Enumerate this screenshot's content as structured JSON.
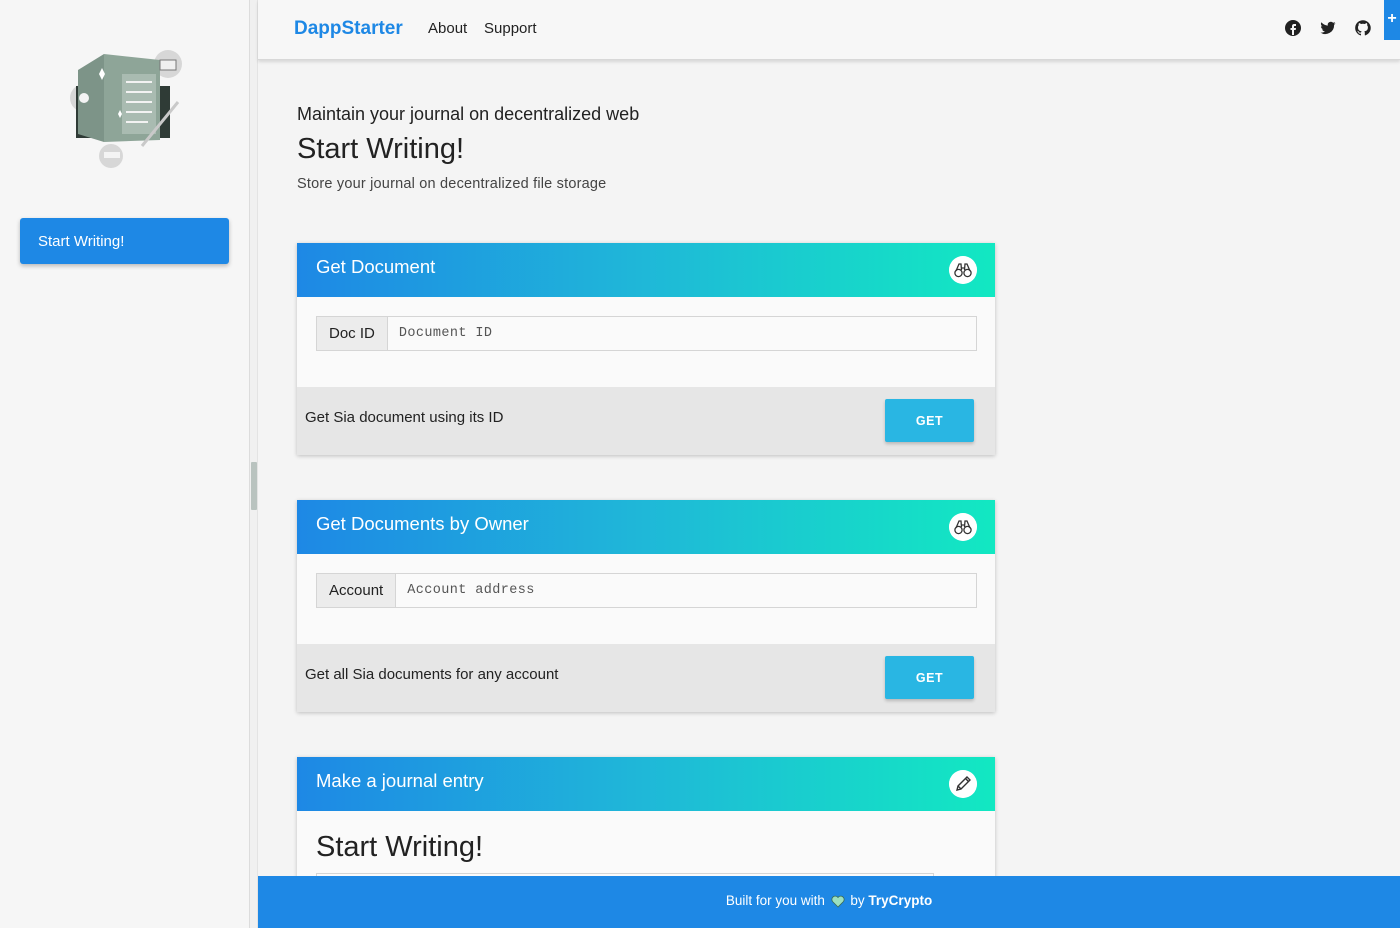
{
  "sidebar": {
    "logo_icon": "journal-illustration-icon",
    "items": [
      {
        "label": "Start Writing!"
      }
    ]
  },
  "header": {
    "brand": "DappStarter",
    "nav": [
      {
        "label": "About"
      },
      {
        "label": "Support"
      }
    ],
    "social_icons": [
      "facebook-icon",
      "twitter-icon",
      "github-icon"
    ],
    "corner_label": "+"
  },
  "intro": {
    "subtitle": "Maintain your journal on decentralized web",
    "title": "Start Writing!",
    "description": "Store your journal on decentralized file storage"
  },
  "cards": [
    {
      "title": "Get Document",
      "icon": "binoculars-icon",
      "field_label": "Doc ID",
      "field_placeholder": "Document ID",
      "footer_text": "Get Sia document using its ID",
      "button_label": "GET"
    },
    {
      "title": "Get Documents by Owner",
      "icon": "binoculars-icon",
      "field_label": "Account",
      "field_placeholder": "Account address",
      "footer_text": "Get all Sia documents for any account",
      "button_label": "GET"
    },
    {
      "title": "Make a journal entry",
      "icon": "pencil-icon",
      "heading": "Start Writing!"
    }
  ],
  "footer": {
    "prefix": "Built for you with",
    "heart_icon": "heart-icon",
    "by": "by",
    "brand": "TryCrypto"
  },
  "colors": {
    "primary": "#1e88e5",
    "button": "#29b6e3",
    "gradient_start": "#1e88e5",
    "gradient_end": "#12e8c2"
  }
}
